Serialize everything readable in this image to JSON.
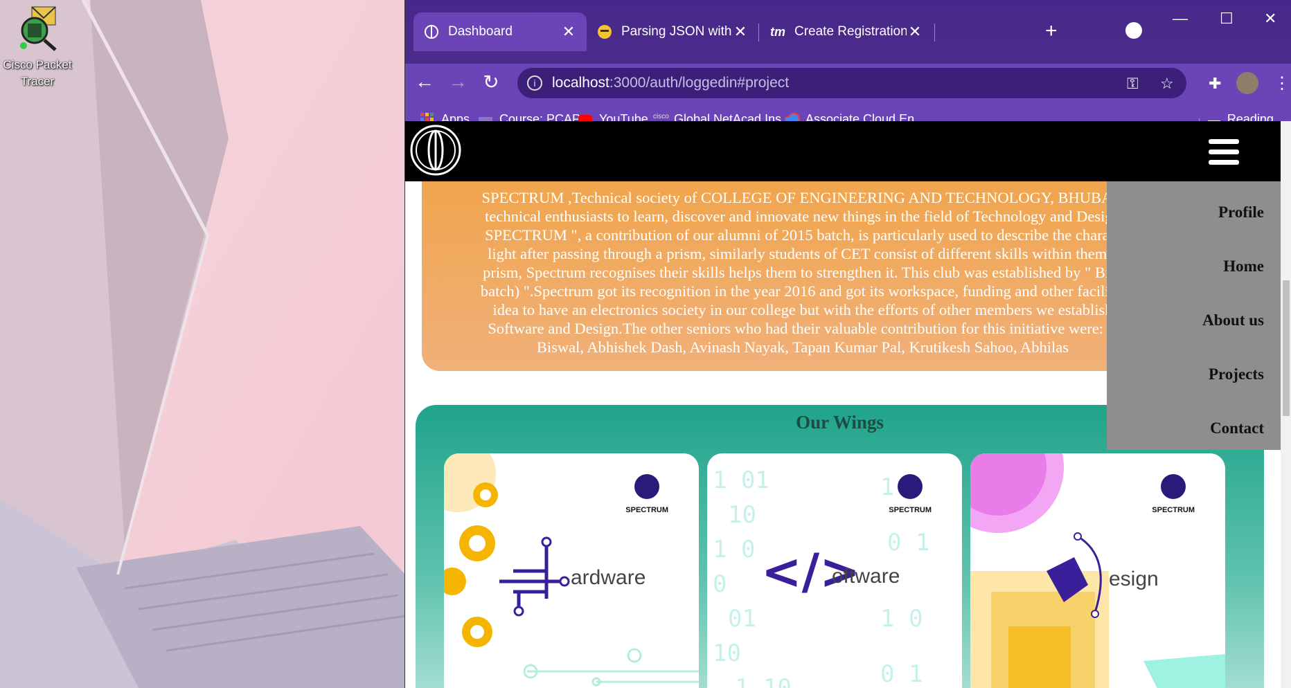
{
  "desktop": {
    "icon_label_line1": "Cisco Packet",
    "icon_label_line2": "Tracer"
  },
  "browser": {
    "tabs": [
      {
        "title": "Dashboard",
        "close": "✕",
        "active": true
      },
      {
        "title": "Parsing JSON with Node.",
        "close": "✕",
        "active": false
      },
      {
        "title": "Create Registration and L",
        "close": "✕",
        "active": false
      }
    ],
    "new_tab": "+",
    "window_controls": {
      "minimize": "—",
      "maximize": "☐",
      "close": "✕"
    },
    "nav": {
      "back": "←",
      "forward": "→",
      "reload": "↻"
    },
    "url_host": "localhost",
    "url_rest": ":3000/auth/loggedin#project",
    "bookmarks": [
      {
        "label": "Apps",
        "color": "#e8453c"
      },
      {
        "label": "Course: PCAP",
        "color": "#888888"
      },
      {
        "label": "YouTube",
        "color": "#ff0000"
      },
      {
        "label": "Global NetAcad Ins...",
        "color": "#cccccc"
      },
      {
        "label": "Associate Cloud En...",
        "color": "#4285f4"
      }
    ],
    "reading_list": "Reading list"
  },
  "site": {
    "about_lines": [
      "SPECTRUM ,Technical society of COLLEGE OF ENGINEERING AND TECHNOLOGY, BHUBAN",
      "technical enthusiasts to learn, discover and innovate new things in the field of Technology and Design",
      "SPECTRUM \", a contribution of our alumni of 2015 batch, is particularly used to describe the charact",
      "light after passing through a prism, similarly students of CET consist of different skills within them a",
      "prism, Spectrum recognises their skills helps them to strengthen it. This club was established by \" Bikr",
      "batch) \".Spectrum got its recognition in the year 2016 and got its workspace, funding and other facilitie",
      "idea to have an electronics society in our college but with the efforts of other members we establish",
      "Software and Design.The other seniors who had their valuable contribution for this initiative were: A",
      "Biswal, Abhishek Dash, Avinash Nayak, Tapan Kumar Pal, Krutikesh Sahoo, Abhilas"
    ],
    "wings_title": "Our Wings",
    "cards": [
      {
        "brand": "SPECTRUM",
        "word": "ardware"
      },
      {
        "brand": "SPECTRUM",
        "word": "oftware"
      },
      {
        "brand": "SPECTRUM",
        "word": "esign"
      }
    ],
    "menu": [
      "Profile",
      "Home",
      "About us",
      "Projects",
      "Contact"
    ]
  }
}
